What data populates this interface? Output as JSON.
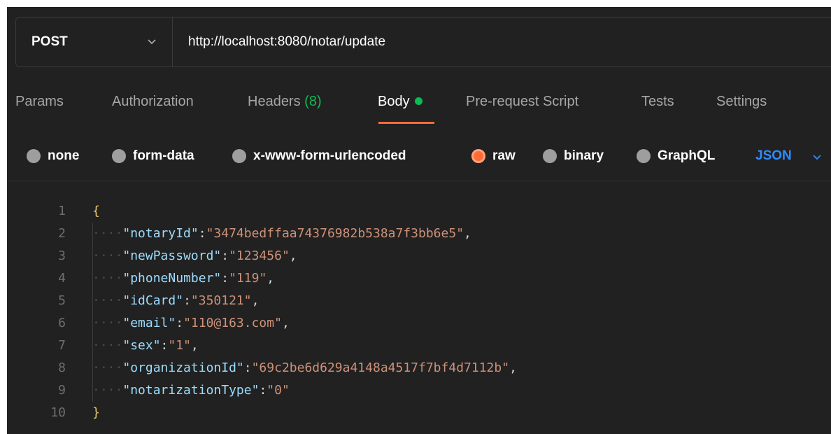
{
  "request": {
    "method": "POST",
    "url": "http://localhost:8080/notar/update"
  },
  "tabs": [
    {
      "label": "Params"
    },
    {
      "label": "Authorization"
    },
    {
      "label": "Headers",
      "count": "(8)"
    },
    {
      "label": "Body",
      "active": true
    },
    {
      "label": "Pre-request Script"
    },
    {
      "label": "Tests"
    },
    {
      "label": "Settings"
    }
  ],
  "body_types": [
    {
      "label": "none",
      "checked": false
    },
    {
      "label": "form-data",
      "checked": false
    },
    {
      "label": "x-www-form-urlencoded",
      "checked": false
    },
    {
      "label": "raw",
      "checked": true
    },
    {
      "label": "binary",
      "checked": false
    },
    {
      "label": "GraphQL",
      "checked": false
    }
  ],
  "format": "JSON",
  "editor": {
    "lines": [
      {
        "n": "1",
        "open": "{"
      },
      {
        "n": "2",
        "key": "\"notaryId\"",
        "value": "\"3474bedffaa74376982b538a7f3bb6e5\"",
        "comma": true
      },
      {
        "n": "3",
        "key": "\"newPassword\"",
        "value": "\"123456\"",
        "comma": true
      },
      {
        "n": "4",
        "key": "\"phoneNumber\"",
        "value": "\"119\"",
        "comma": true
      },
      {
        "n": "5",
        "key": "\"idCard\"",
        "value": "\"350121\"",
        "comma": true
      },
      {
        "n": "6",
        "key": "\"email\"",
        "value": "\"110@163.com\"",
        "comma": true
      },
      {
        "n": "7",
        "key": "\"sex\"",
        "value": "\"1\"",
        "comma": true
      },
      {
        "n": "8",
        "key": "\"organizationId\"",
        "value": "\"69c2be6d629a4148a4517f7bf4d7112b\"",
        "comma": true
      },
      {
        "n": "9",
        "key": "\"notarizationType\"",
        "value": "\"0\"",
        "comma": false
      },
      {
        "n": "10",
        "close": "}"
      }
    ]
  },
  "colors": {
    "accent": "#ff6c37",
    "green": "#0cbb52",
    "json_blue": "#2f8cff"
  }
}
